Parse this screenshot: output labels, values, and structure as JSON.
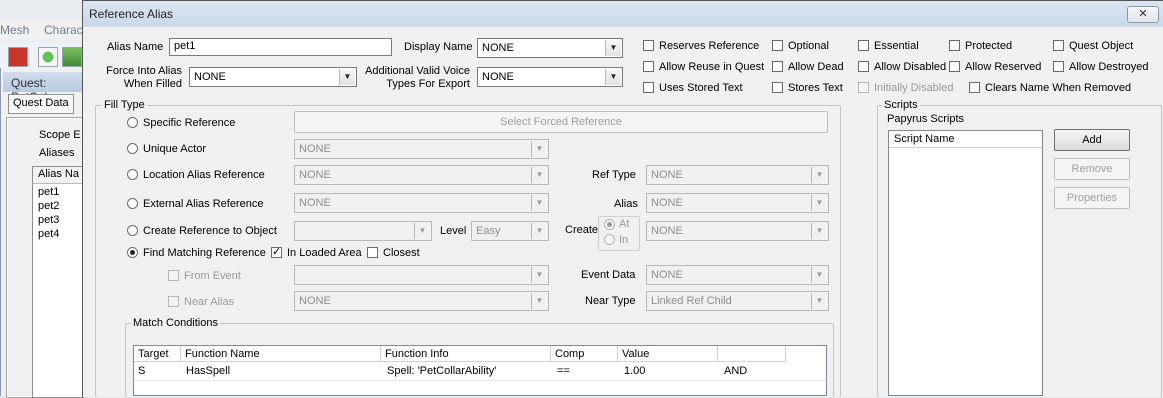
{
  "background_app": {
    "menu": [
      "Mesh",
      "Charac"
    ],
    "quest_window_title": "Quest: PetCol",
    "quest_data_tab": "Quest Data",
    "scope_label": "Scope E",
    "aliases_label": "Aliases",
    "alias_column": "Alias Na",
    "aliases": [
      "pet1",
      "pet2",
      "pet3",
      "pet4"
    ]
  },
  "dialog": {
    "title": "Reference Alias",
    "close_glyph": "✕",
    "alias_name_label": "Alias Name",
    "alias_name_value": "pet1",
    "display_name_label": "Display Name",
    "display_name_value": "NONE",
    "force_into_alias_label_1": "Force Into Alias",
    "force_into_alias_label_2": "When Filled",
    "force_into_alias_value": "NONE",
    "voice_types_label_1": "Additional Valid Voice",
    "voice_types_label_2": "Types For Export",
    "voice_types_value": "NONE",
    "flags": [
      {
        "label": "Reserves Reference",
        "checked": false,
        "enabled": true
      },
      {
        "label": "Optional",
        "checked": false,
        "enabled": true
      },
      {
        "label": "Essential",
        "checked": false,
        "enabled": true
      },
      {
        "label": "Protected",
        "checked": false,
        "enabled": true
      },
      {
        "label": "Quest Object",
        "checked": false,
        "enabled": true
      },
      {
        "label": "Allow Reuse in Quest",
        "checked": false,
        "enabled": true
      },
      {
        "label": "Allow Dead",
        "checked": false,
        "enabled": true
      },
      {
        "label": "Allow Disabled",
        "checked": false,
        "enabled": true
      },
      {
        "label": "Allow Reserved",
        "checked": false,
        "enabled": true
      },
      {
        "label": "Allow Destroyed",
        "checked": false,
        "enabled": true
      },
      {
        "label": "Uses Stored Text",
        "checked": false,
        "enabled": true
      },
      {
        "label": "Stores Text",
        "checked": false,
        "enabled": true
      },
      {
        "label": "Initially Disabled",
        "checked": false,
        "enabled": false
      },
      {
        "label": "Clears Name When Removed",
        "checked": false,
        "enabled": true
      }
    ],
    "fill_type": {
      "title": "Fill Type",
      "specific_reference": "Specific Reference",
      "select_forced_reference": "Select Forced Reference",
      "unique_actor": "Unique Actor",
      "unique_actor_value": "NONE",
      "location_alias_reference": "Location Alias Reference",
      "location_alias_value": "NONE",
      "ref_type_label": "Ref Type",
      "ref_type_value": "NONE",
      "external_alias_reference": "External Alias Reference",
      "external_alias_value": "NONE",
      "alias_label": "Alias",
      "alias_value": "NONE",
      "create_reference_to_object": "Create Reference to Object",
      "create_object_value": "",
      "level_label": "Level",
      "level_value": "Easy",
      "create_label": "Create",
      "create_at": "At",
      "create_in": "In",
      "create_target_value": "NONE",
      "find_matching_reference": "Find Matching Reference",
      "in_loaded_area": "In Loaded Area",
      "in_loaded_area_checked": true,
      "closest": "Closest",
      "closest_checked": false,
      "from_event": "From Event",
      "from_event_value": "",
      "event_data_label": "Event Data",
      "event_data_value": "NONE",
      "near_alias": "Near Alias",
      "near_alias_value": "NONE",
      "near_type_label": "Near Type",
      "near_type_value": "Linked Ref Child",
      "selected": "find_matching_reference"
    },
    "match_conditions": {
      "title": "Match Conditions",
      "columns": [
        "Target",
        "Function Name",
        "Function Info",
        "Comp",
        "Value",
        ""
      ],
      "rows": [
        [
          "S",
          "HasSpell",
          "Spell: 'PetCollarAbility'",
          "==",
          "1.00",
          "AND"
        ]
      ]
    },
    "scripts": {
      "title": "Scripts",
      "papyrus_label": "Papyrus Scripts",
      "column": "Script Name",
      "add": "Add",
      "remove": "Remove",
      "properties": "Properties"
    }
  }
}
